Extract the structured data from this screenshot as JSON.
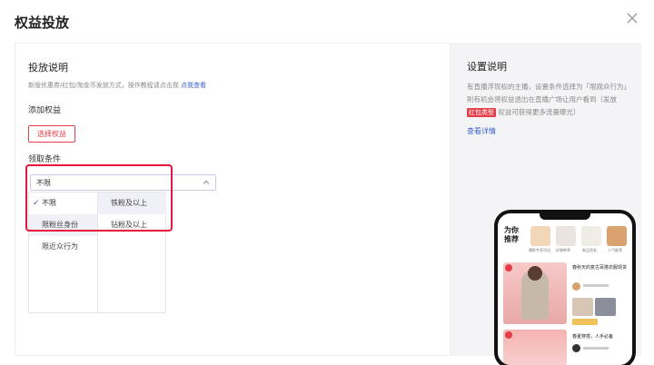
{
  "modal": {
    "title": "权益投放"
  },
  "left": {
    "section_title": "投放说明",
    "description": "新版优惠券/红包/淘金币发放方式，操作教程请点击我",
    "description_link": "点我查看",
    "add_benefit_label": "添加权益",
    "select_benefit_button": "选择权益",
    "condition_label": "领取条件",
    "dropdown": {
      "selected_value": "不限"
    },
    "menu": {
      "column1": [
        {
          "label": "不限",
          "checked": true
        },
        {
          "label": "限粉丝身份",
          "checked": false
        },
        {
          "label": "限近众行为",
          "checked": false
        }
      ],
      "column2": [
        {
          "label": "铁粉及以上"
        },
        {
          "label": "钻粉及以上"
        }
      ]
    }
  },
  "right": {
    "title": "设置说明",
    "description_part1": "有直播浮现权的主播，设置条件选择为「限观众行为」則有机会将权益透出在直播广场让用户看到（发放",
    "tag": "红包类型",
    "description_part2": "权益可获得更多流量曝光）",
    "link": "查看详情",
    "phone": {
      "header": "为你推荐",
      "thumb_captions": [
        "爆款专享活动",
        "好物种草",
        "新品首发",
        "人气推荐"
      ],
      "card1_title": "春秋天的复古百搭衣服现货",
      "card2_title": "春夏穿搭，人手必备"
    }
  },
  "colors": {
    "accent_red": "#e53e48",
    "highlight_red": "#e8163a",
    "link_blue": "#3a5fcd",
    "check_blue": "#4a55b8"
  }
}
